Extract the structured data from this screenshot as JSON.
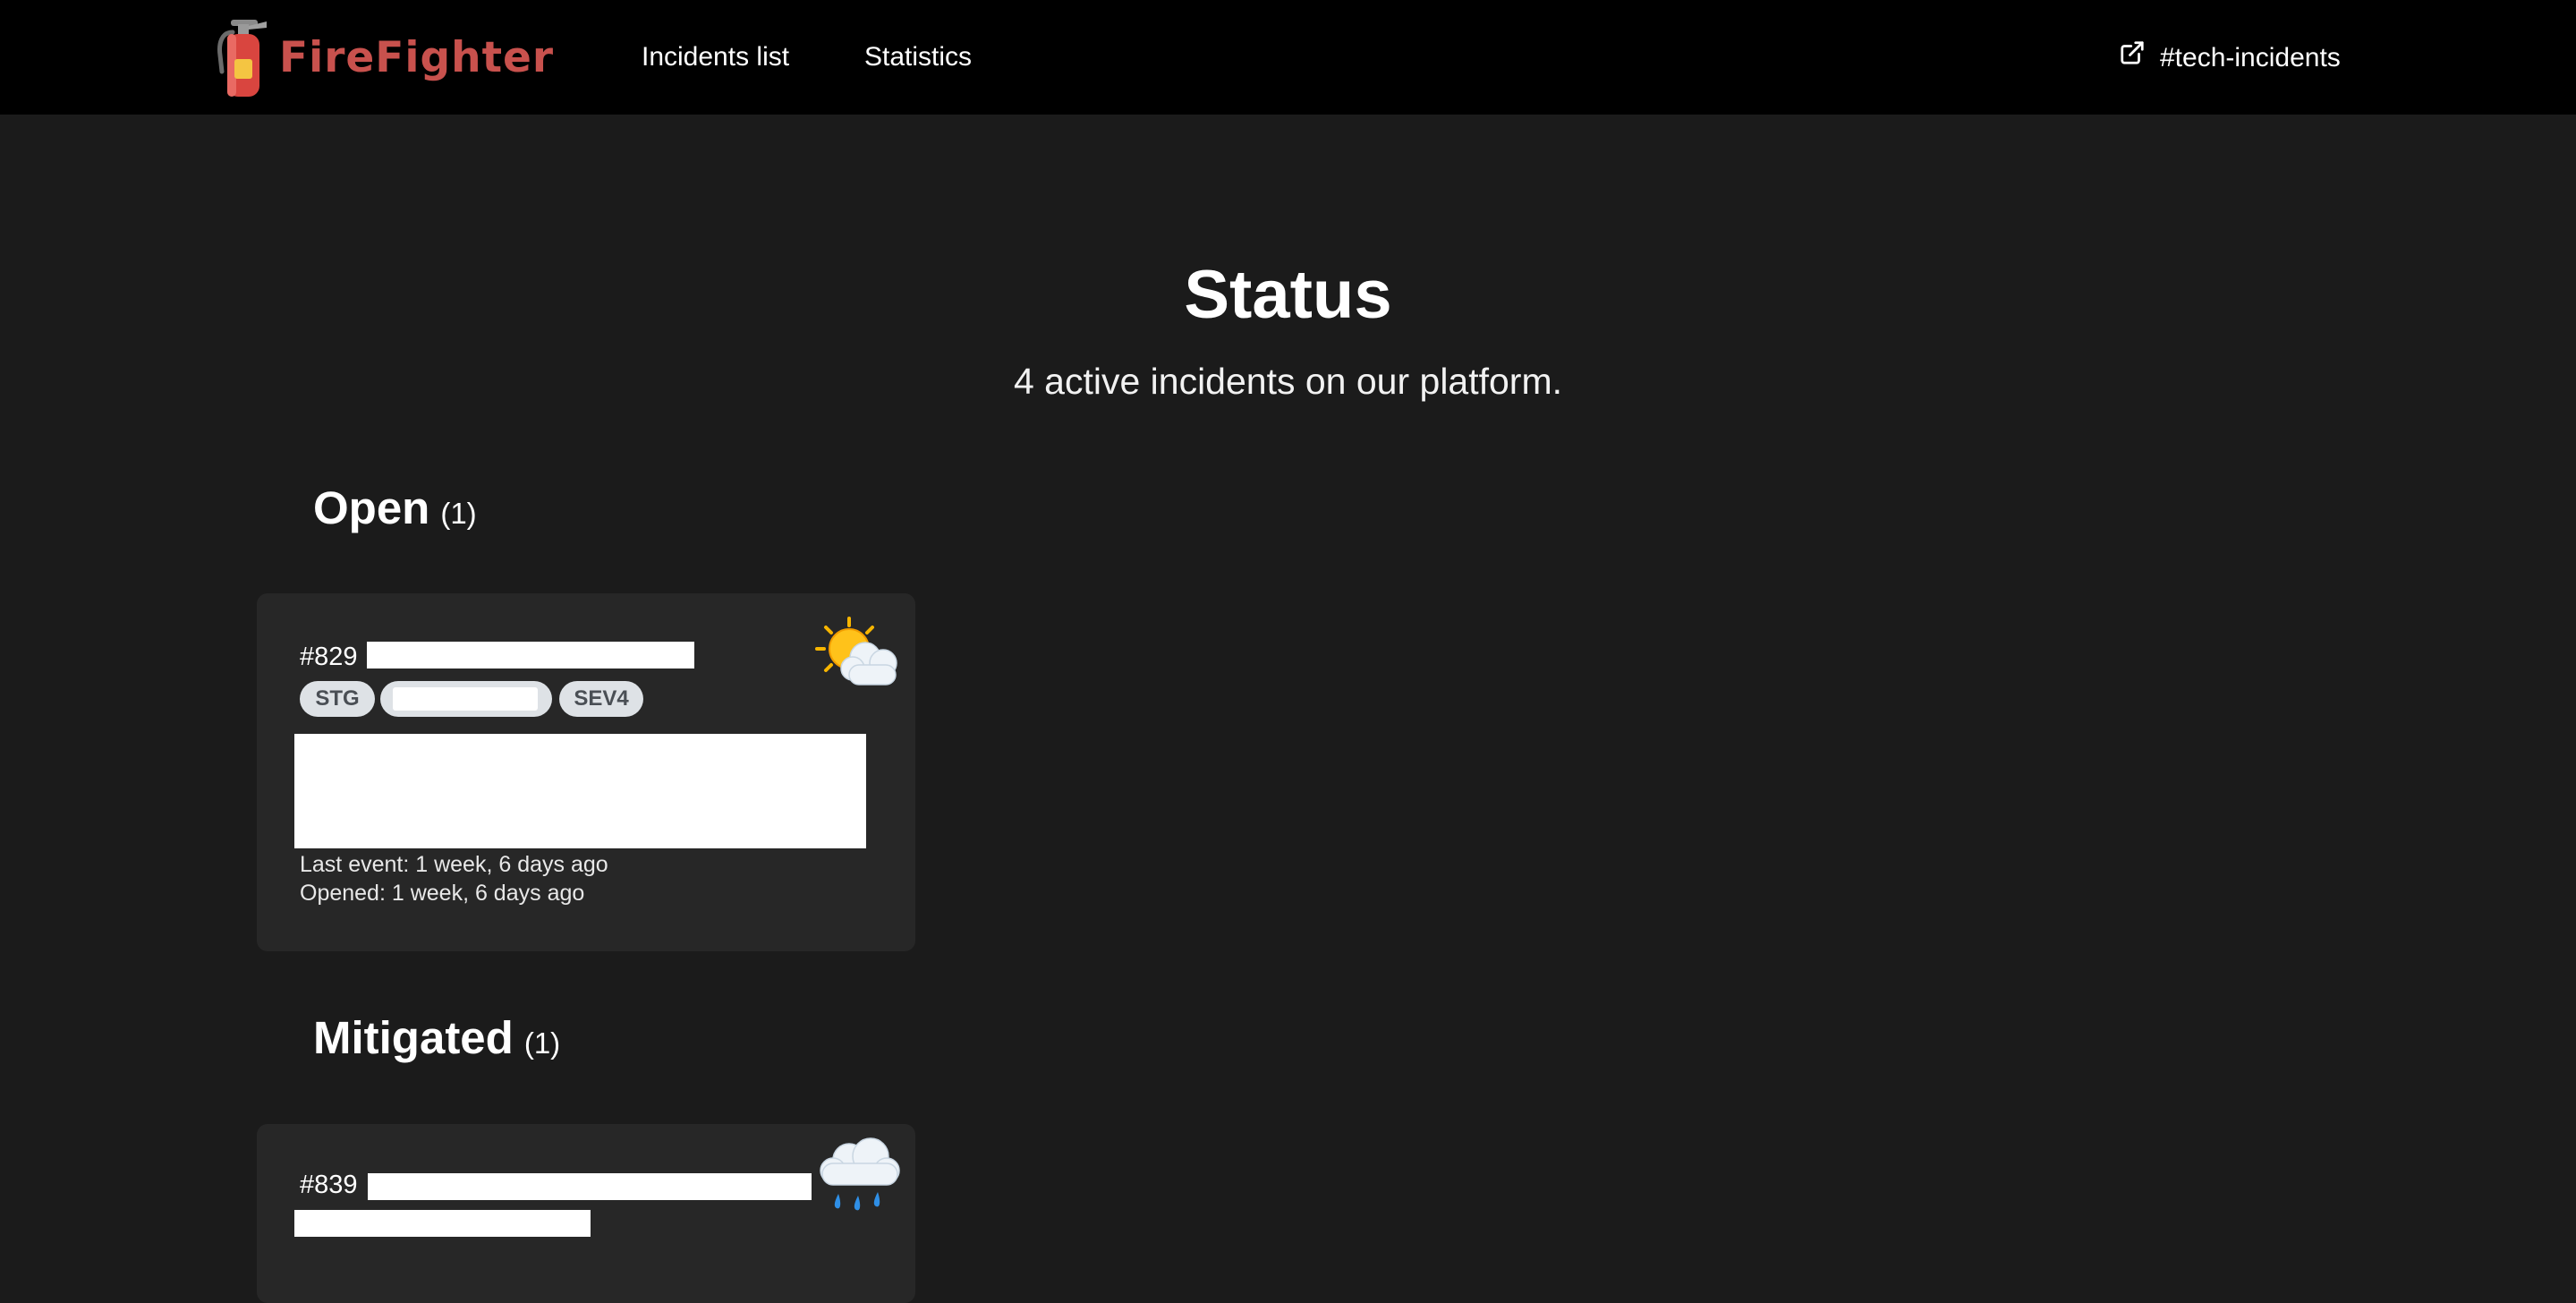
{
  "app": {
    "brand_name": "FireFighter",
    "brand_icon": "fire-extinguisher-icon",
    "brand_color": "#c8514d"
  },
  "nav": {
    "incidents_list": "Incidents list",
    "statistics": "Statistics",
    "slack_channel": "#tech-incidents",
    "slack_icon": "external-link-icon"
  },
  "hero": {
    "title": "Status",
    "subtitle": "4 active incidents on our platform."
  },
  "sections": {
    "open": {
      "title": "Open",
      "count": "(1)",
      "incidents": [
        {
          "id": "#829",
          "environment": "STG",
          "priority": "SEV4",
          "last_event": "Last event: 1 week, 6 days ago",
          "opened": "Opened: 1 week, 6 days ago",
          "weather_icon": "sun-behind-cloud-icon"
        }
      ]
    },
    "mitigated": {
      "title": "Mitigated",
      "count": "(1)",
      "incidents": [
        {
          "id": "#839",
          "weather_icon": "cloud-with-rain-icon"
        }
      ]
    }
  },
  "colors": {
    "page_background": "#1b1b1b",
    "navbar_background": "#000000",
    "card_background": "#272727",
    "badge_background": "#dee2e6"
  }
}
